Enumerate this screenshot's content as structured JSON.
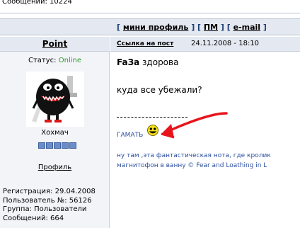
{
  "header": {
    "messages_text": "Сообщений: 10224"
  },
  "actions": {
    "mini_profile": "мини профиль",
    "pm": "ПМ",
    "email": "e-mail"
  },
  "user": {
    "name": "Point",
    "status_label": "Статус:",
    "status_value": "Online",
    "rank": "Хохмач",
    "rank_pips": 5,
    "profile_link": "Профиль",
    "registration": "Регистрация: 29.04.2008",
    "user_number": "Пользователь №: 56126",
    "group": "Группа: Пользователи",
    "posts": "Сообщений: 664"
  },
  "post": {
    "link_label": "Ссылка на пост",
    "date": "24.11.2008 - 18:10",
    "line1_bold": "FaЗa",
    "line1_rest": "здорова",
    "line2": "куда все убежали?",
    "signature_link": "ГАМАТЬ",
    "signature_line2": "ну там ,эта фантастическая нота, где кролик",
    "signature_line3": "магнитофон в ванну © Fear and Loathing in L"
  },
  "colors": {
    "bar_background": "#e4e8f0",
    "online": "#2e9b2e",
    "signature_text": "#2a4fa0",
    "arrow": "#e8141c"
  }
}
